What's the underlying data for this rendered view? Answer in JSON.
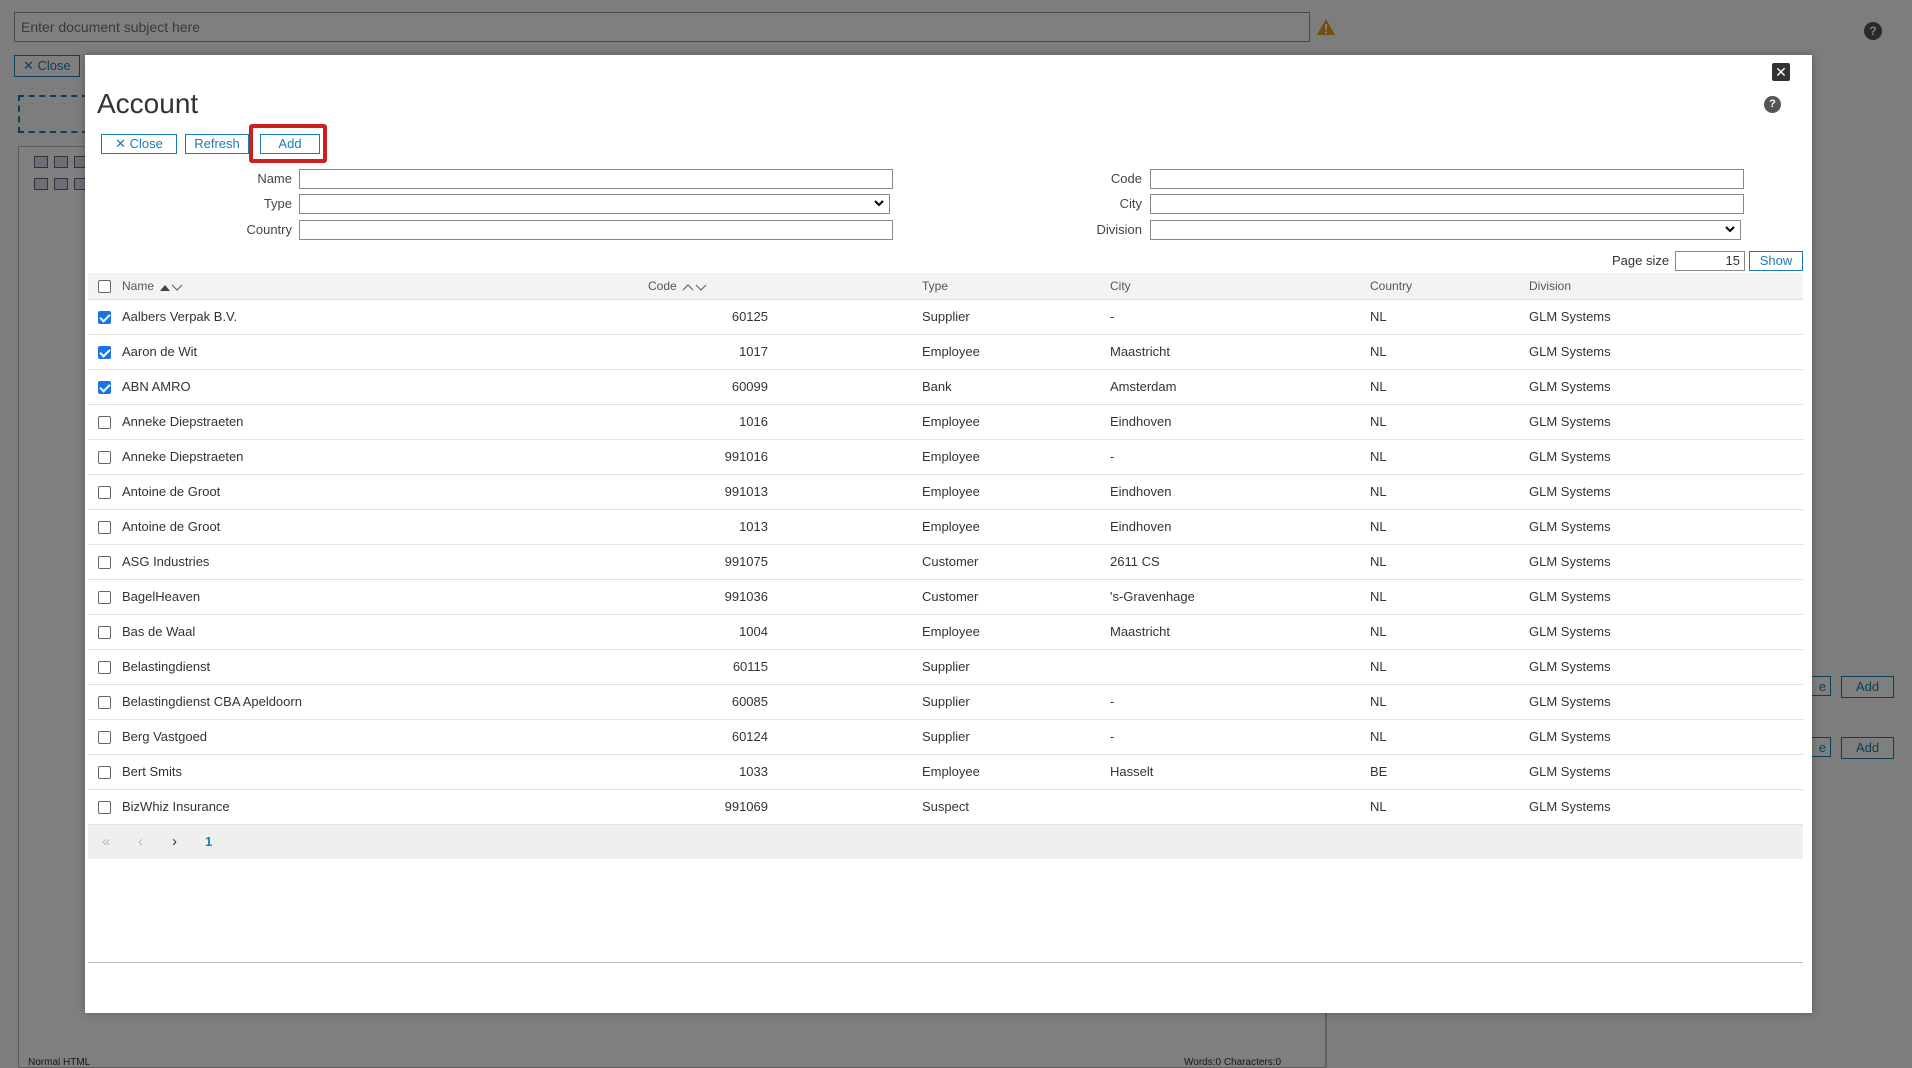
{
  "background": {
    "subject_placeholder": "Enter document subject here",
    "help_label": "?",
    "close_label": "Close",
    "footer_left": "Normal  HTML",
    "footer_right": "Words:0 Characters:0",
    "right_add_label": "Add",
    "right_ve_label": "e"
  },
  "colors": {
    "accent": "#1a7db5",
    "highlight": "#cc1f1f",
    "checkbox": "#1a73e8",
    "warning": "#e0a020"
  },
  "modal": {
    "title": "Account",
    "close_icon": "close-icon",
    "help_label": "?",
    "toolbar": {
      "close_label": "Close",
      "refresh_label": "Refresh",
      "add_label": "Add"
    },
    "filters": {
      "name_label": "Name",
      "type_label": "Type",
      "country_label": "Country",
      "code_label": "Code",
      "city_label": "City",
      "division_label": "Division",
      "name_value": "",
      "type_value": "",
      "country_value": "",
      "code_value": "",
      "city_value": "",
      "division_value": ""
    },
    "page_size_label": "Page size",
    "page_size_value": "15",
    "show_label": "Show",
    "columns": {
      "name": "Name",
      "code": "Code",
      "type": "Type",
      "city": "City",
      "country": "Country",
      "division": "Division"
    },
    "rows": [
      {
        "checked": true,
        "name": "Aalbers Verpak B.V.",
        "code": "60125",
        "type": "Supplier",
        "city": "-",
        "country": "NL",
        "division": "GLM Systems"
      },
      {
        "checked": true,
        "name": "Aaron de Wit",
        "code": "1017",
        "type": "Employee",
        "city": "Maastricht",
        "country": "NL",
        "division": "GLM Systems"
      },
      {
        "checked": true,
        "name": "ABN AMRO",
        "code": "60099",
        "type": "Bank",
        "city": "Amsterdam",
        "country": "NL",
        "division": "GLM Systems"
      },
      {
        "checked": false,
        "name": "Anneke Diepstraeten",
        "code": "1016",
        "type": "Employee",
        "city": "Eindhoven",
        "country": "NL",
        "division": "GLM Systems"
      },
      {
        "checked": false,
        "name": "Anneke Diepstraeten",
        "code": "991016",
        "type": "Employee",
        "city": "-",
        "country": "NL",
        "division": "GLM Systems"
      },
      {
        "checked": false,
        "name": "Antoine de Groot",
        "code": "991013",
        "type": "Employee",
        "city": "Eindhoven",
        "country": "NL",
        "division": "GLM Systems"
      },
      {
        "checked": false,
        "name": "Antoine de Groot",
        "code": "1013",
        "type": "Employee",
        "city": "Eindhoven",
        "country": "NL",
        "division": "GLM Systems"
      },
      {
        "checked": false,
        "name": "ASG Industries",
        "code": "991075",
        "type": "Customer",
        "city": "2611 CS",
        "country": "NL",
        "division": "GLM Systems"
      },
      {
        "checked": false,
        "name": "BagelHeaven",
        "code": "991036",
        "type": "Customer",
        "city": "'s-Gravenhage",
        "country": "NL",
        "division": "GLM Systems"
      },
      {
        "checked": false,
        "name": "Bas de Waal",
        "code": "1004",
        "type": "Employee",
        "city": "Maastricht",
        "country": "NL",
        "division": "GLM Systems"
      },
      {
        "checked": false,
        "name": "Belastingdienst",
        "code": "60115",
        "type": "Supplier",
        "city": "",
        "country": "NL",
        "division": "GLM Systems"
      },
      {
        "checked": false,
        "name": "Belastingdienst CBA Apeldoorn",
        "code": "60085",
        "type": "Supplier",
        "city": "-",
        "country": "NL",
        "division": "GLM Systems"
      },
      {
        "checked": false,
        "name": "Berg Vastgoed",
        "code": "60124",
        "type": "Supplier",
        "city": "-",
        "country": "NL",
        "division": "GLM Systems"
      },
      {
        "checked": false,
        "name": "Bert Smits",
        "code": "1033",
        "type": "Employee",
        "city": "Hasselt",
        "country": "BE",
        "division": "GLM Systems"
      },
      {
        "checked": false,
        "name": "BizWhiz Insurance",
        "code": "991069",
        "type": "Suspect",
        "city": "",
        "country": "NL",
        "division": "GLM Systems"
      }
    ],
    "pager": {
      "current_page": "1"
    }
  }
}
